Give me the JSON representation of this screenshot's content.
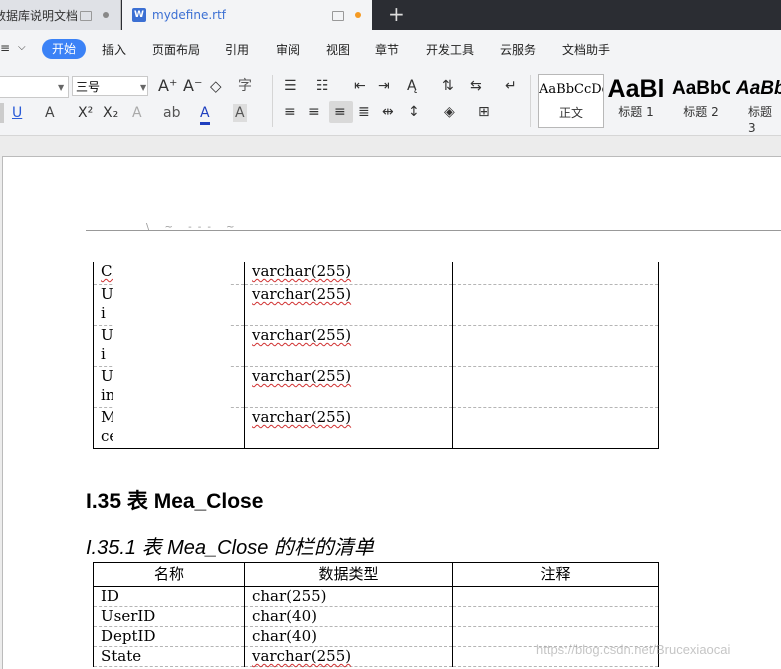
{
  "tabs": [
    {
      "label": "数据库说明文档"
    },
    {
      "label": "mydefine.rtf"
    }
  ],
  "menu": {
    "items": [
      "开始",
      "插入",
      "页面布局",
      "引用",
      "审阅",
      "视图",
      "章节",
      "开发工具",
      "云服务",
      "文档助手"
    ]
  },
  "toolbar": {
    "font_size": "三号",
    "styles": [
      {
        "sample": "AaBbCcDd",
        "name": "正文"
      },
      {
        "sample": "AaBl",
        "name": "标题 1"
      },
      {
        "sample": "AaBbC",
        "name": "标题 2"
      },
      {
        "sample": "AaBbC",
        "name": "标题 3"
      }
    ]
  },
  "document": {
    "table1": {
      "rows": [
        {
          "name": "Cl",
          "type": "varchar(255)",
          "note": ""
        },
        {
          "name": "U\ni",
          "type": "varchar(255)",
          "note": ""
        },
        {
          "name": "U\ni",
          "type": "varchar(255)",
          "note": ""
        },
        {
          "name": "U\ninfo",
          "type": "varchar(255)",
          "note": ""
        },
        {
          "name": "M\nce",
          "type": "varchar(255)",
          "note": ""
        }
      ]
    },
    "heading2": "I.35 表 Mea_Close",
    "heading3": "I.35.1 表 Mea_Close 的栏的清单",
    "table2": {
      "headers": [
        "名称",
        "数据类型",
        "注释"
      ],
      "rows": [
        {
          "name": "ID",
          "type": "char(255)",
          "note": ""
        },
        {
          "name": "UserID",
          "type": "char(40)",
          "note": ""
        },
        {
          "name": "DeptID",
          "type": "char(40)",
          "note": ""
        },
        {
          "name": "State",
          "type": "varchar(255)",
          "note": ""
        }
      ]
    },
    "watermark": "https://blog.csdn.net/Brucexiaocai"
  },
  "colors": {
    "accent": "#3b82f6",
    "titlebar": "#2b2d33",
    "tab_active_text": "#3b6fd3",
    "unsaved_dot": "#f59a23"
  }
}
